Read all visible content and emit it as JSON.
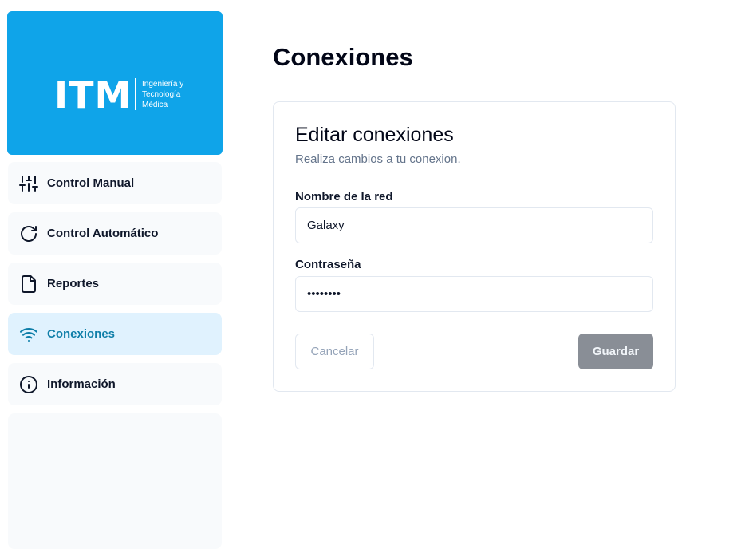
{
  "brand": {
    "logo_text": "ITM",
    "logo_subtitle": [
      "Ingeniería y",
      "Tecnología",
      "Médica"
    ],
    "color": "#0fa4e9"
  },
  "sidebar": {
    "items": [
      {
        "label": "Control Manual",
        "icon": "sliders-icon",
        "active": false
      },
      {
        "label": "Control Automático",
        "icon": "refresh-icon",
        "active": false
      },
      {
        "label": "Reportes",
        "icon": "file-icon",
        "active": false
      },
      {
        "label": "Conexiones",
        "icon": "wifi-icon",
        "active": true
      },
      {
        "label": "Información",
        "icon": "info-icon",
        "active": false
      }
    ]
  },
  "page": {
    "title": "Conexiones"
  },
  "card": {
    "title": "Editar conexiones",
    "description": "Realiza cambios a tu conexion.",
    "network_label": "Nombre de la red",
    "network_value": "Galaxy",
    "password_label": "Contraseña",
    "password_value": "••••••••",
    "cancel_label": "Cancelar",
    "save_label": "Guardar"
  },
  "colors": {
    "active_bg": "#e0f2fe",
    "active_text": "#0e7ea8",
    "save_button": "#898e96"
  }
}
